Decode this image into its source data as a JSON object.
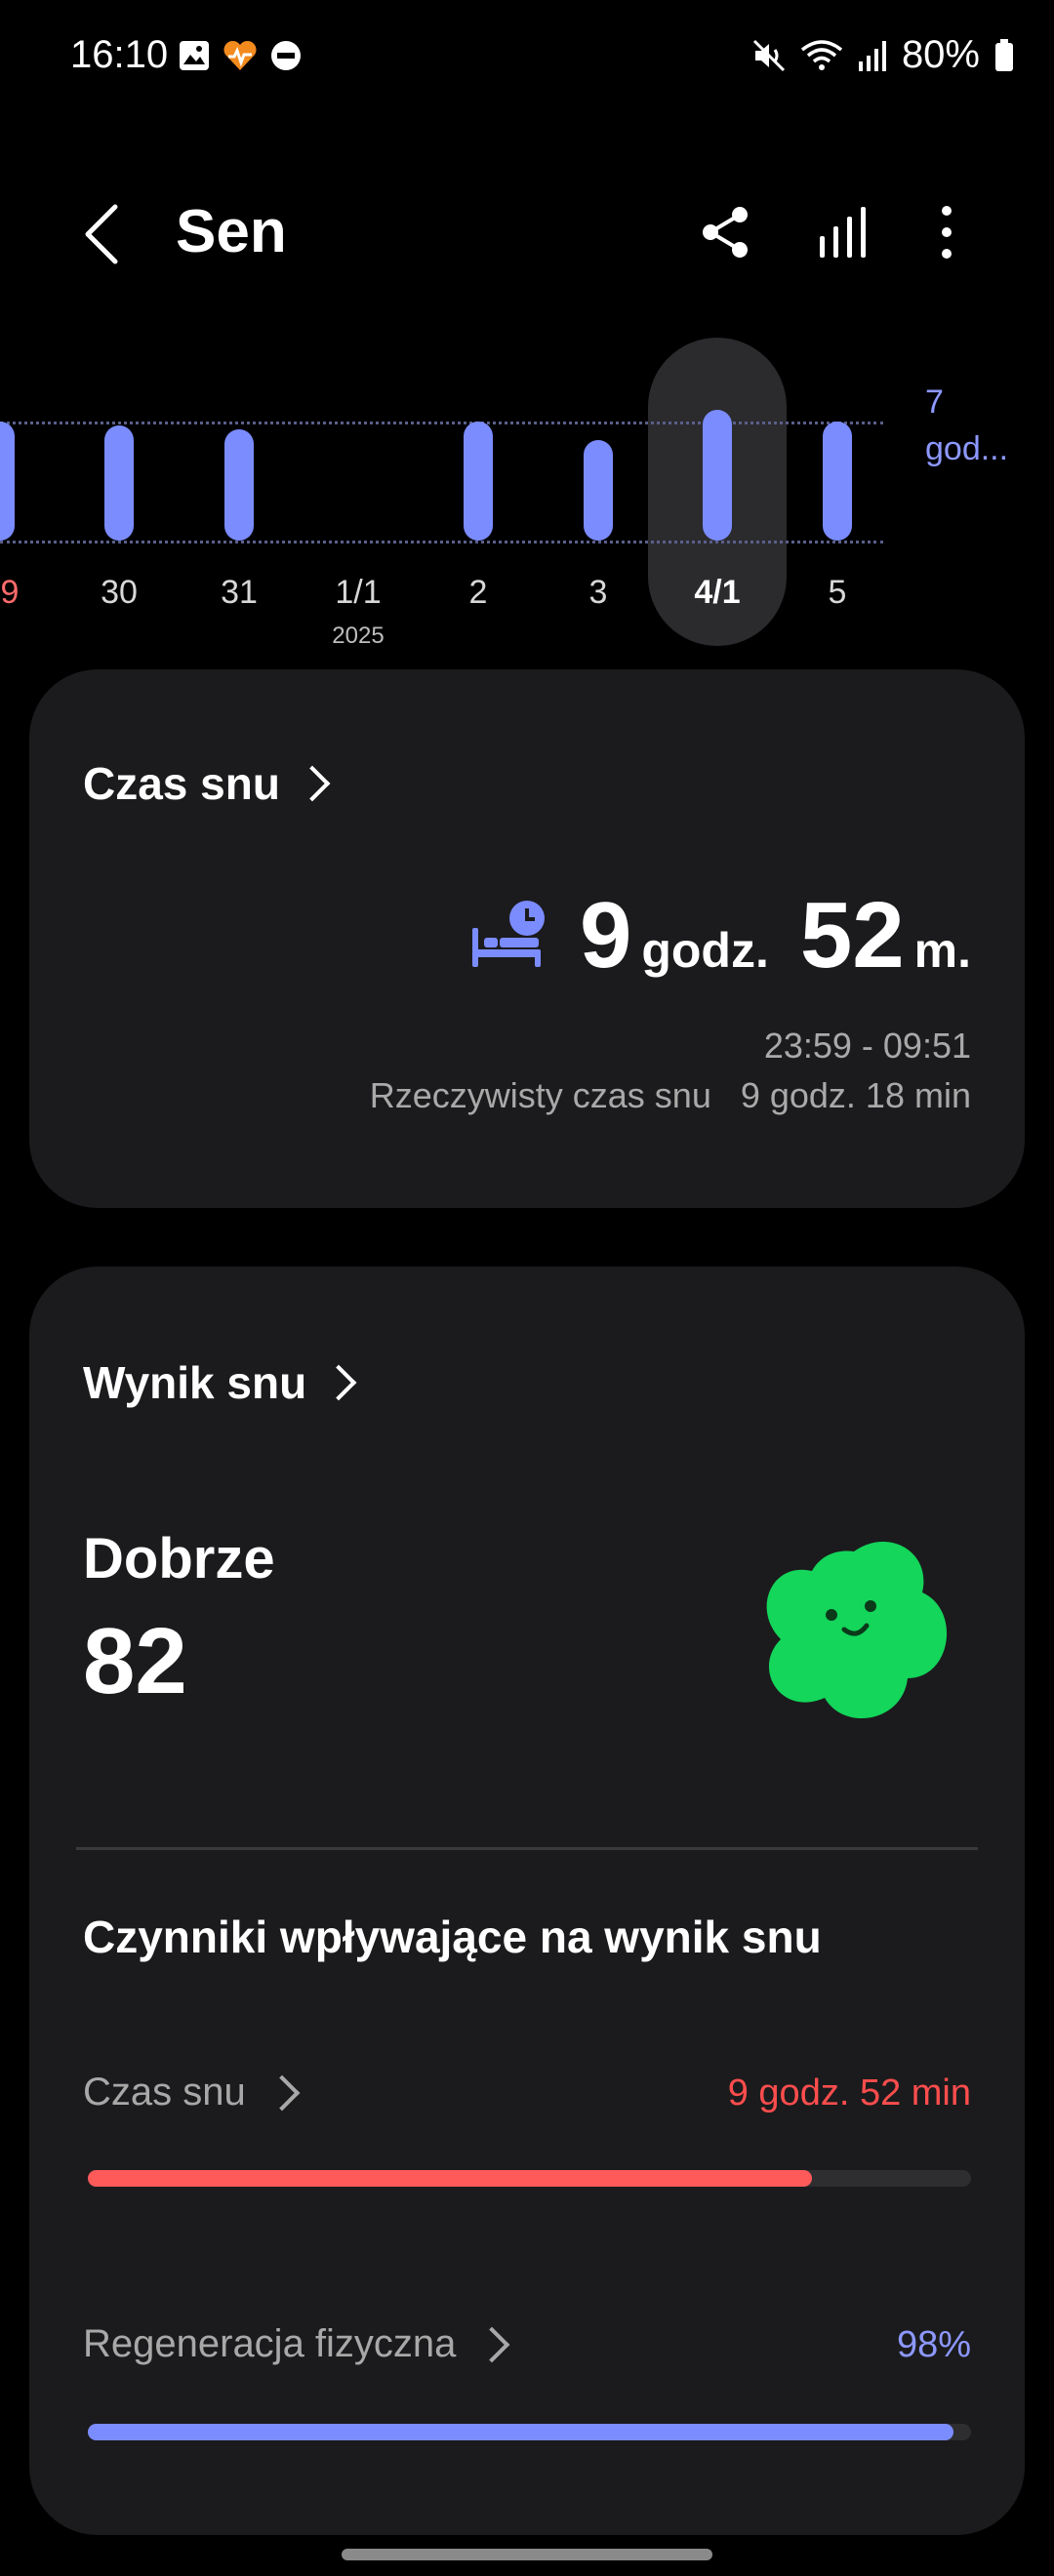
{
  "status_bar": {
    "time": "16:10",
    "battery": "80%",
    "icons_left": [
      "gallery-icon",
      "heart-rate-app-icon",
      "do-not-disturb-icon"
    ],
    "icons_right": [
      "mute-icon",
      "wifi-icon",
      "signal-icon",
      "battery-icon"
    ]
  },
  "app_bar": {
    "title": "Sen",
    "actions": [
      "share-icon",
      "chart-icon",
      "more-icon"
    ]
  },
  "timeline": {
    "goal_label_line1": "7",
    "goal_label_line2": "god...",
    "days": [
      {
        "label": "9",
        "sub": "",
        "hours": 9.0,
        "color": "red"
      },
      {
        "label": "30",
        "sub": "",
        "hours": 8.7
      },
      {
        "label": "31",
        "sub": "",
        "hours": 8.4
      },
      {
        "label": "1/1",
        "sub": "2025",
        "hours": null
      },
      {
        "label": "2",
        "sub": "",
        "hours": 9.0
      },
      {
        "label": "3",
        "sub": "",
        "hours": 7.6
      },
      {
        "label": "4/1",
        "sub": "",
        "hours": 9.87,
        "selected": true
      },
      {
        "label": "5",
        "sub": "",
        "hours": 9.0
      }
    ],
    "accent_color": "#7b8cff"
  },
  "sleep_time_card": {
    "title": "Czas snu",
    "hours_value": "9",
    "hours_unit": "godz.",
    "minutes_value": "52",
    "minutes_unit": "m.",
    "time_range": "23:59 - 09:51",
    "actual_label": "Rzeczywisty czas snu",
    "actual_value": "9 godz. 18 min"
  },
  "score_card": {
    "title": "Wynik snu",
    "status": "Dobrze",
    "score": "82",
    "factors_title": "Czynniki wpływające na wynik snu",
    "factors": [
      {
        "label": "Czas snu",
        "value": "9 godz. 52 min",
        "progress": 0.82,
        "color": "#ff5a5a"
      },
      {
        "label": "Regeneracja fizyczna",
        "value": "98%",
        "progress": 0.98,
        "color": "#7b8cff"
      }
    ]
  }
}
